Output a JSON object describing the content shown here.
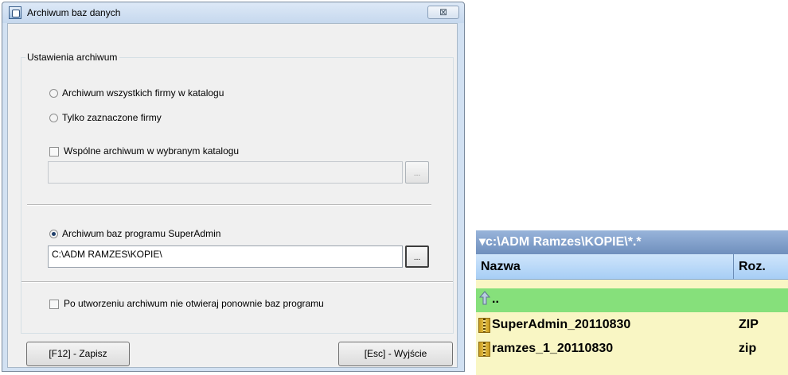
{
  "dialog": {
    "title": "Archiwum baz danych",
    "close_glyph": "⊠",
    "group_title": "Ustawienia archiwum",
    "option_all": "Archiwum wszystkich firmy w katalogu",
    "option_selected": "Tylko zaznaczone firmy",
    "common_archive_label": "Wspólne archiwum w wybranym katalogu",
    "common_archive_path": "",
    "superadmin_label": "Archiwum baz programu SuperAdmin",
    "superadmin_path": "C:\\ADM RAMZES\\KOPIE\\",
    "browse_label": "...",
    "reopen_label": "Po utworzeniu archiwum nie otwieraj ponownie baz programu",
    "save_button": "[F12] - Zapisz",
    "exit_button": "[Esc] - Wyjście",
    "selected_option": "superadmin"
  },
  "panel": {
    "path": "▾c:\\ADM Ramzes\\KOPIE\\*.*",
    "col_name": "Nazwa",
    "col_ext": "Roz.",
    "parent_label": "..",
    "files": [
      {
        "name": "SuperAdmin_20110830",
        "ext": "ZIP"
      },
      {
        "name": "ramzes_1_20110830",
        "ext": "zip"
      }
    ],
    "colors": {
      "background": "#f9f6c4",
      "parent_row": "#86e07b",
      "header": "#a7cef5"
    }
  }
}
